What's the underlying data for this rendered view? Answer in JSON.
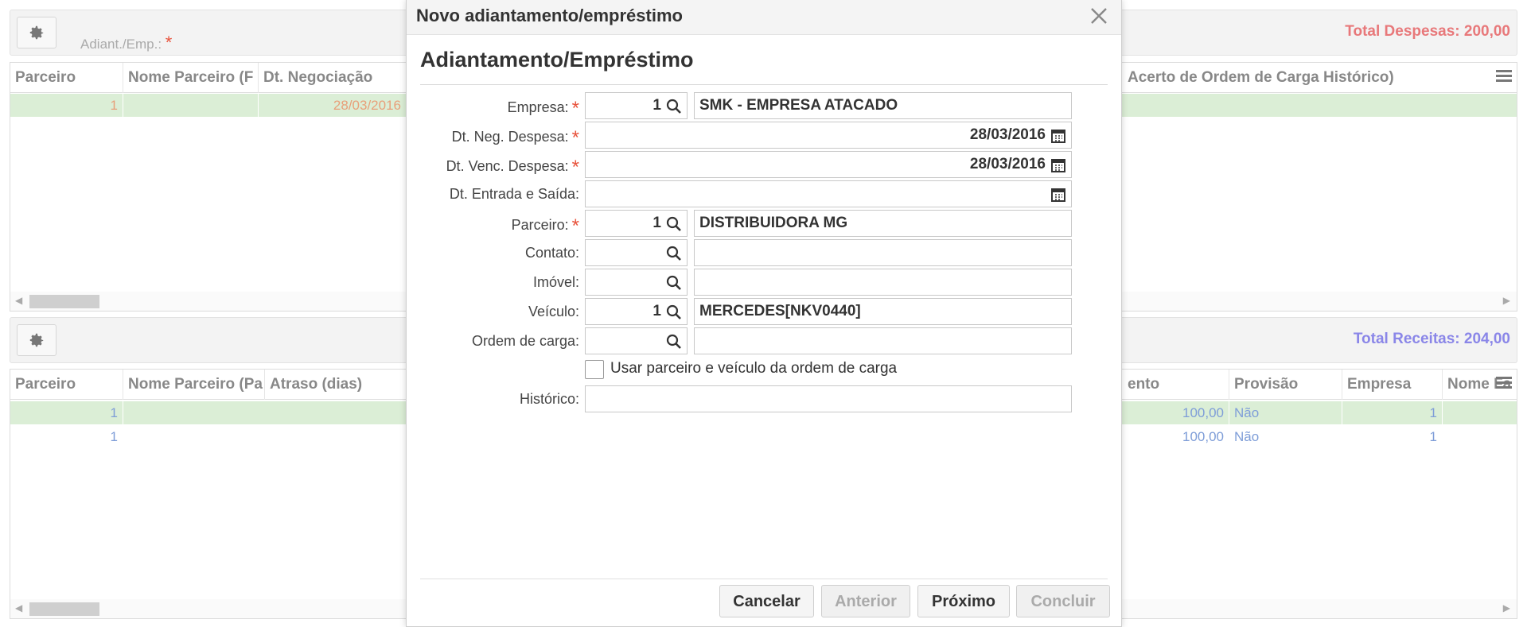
{
  "top_panel": {
    "field_label": "Adiant./Emp.:",
    "required_mark": "*",
    "total": "Total Despesas: 200,00",
    "total_color": "#e8787a"
  },
  "top_grid": {
    "headers": [
      "Parceiro",
      "Nome Parceiro (F",
      "Dt. Negociação",
      "Acerto de Ordem de Carga Histórico)"
    ],
    "rows": [
      {
        "parceiro": "1",
        "nome": "",
        "dt": "28/03/2016"
      }
    ]
  },
  "bottom_panel": {
    "total": "Total Receitas: 204,00",
    "total_color": "#8a86e8"
  },
  "bottom_grid": {
    "headers": [
      "Parceiro",
      "Nome Parceiro (Pa",
      "Atraso (dias)",
      "ento",
      "Provisão",
      "Empresa",
      "Nome Fa"
    ],
    "rows": [
      {
        "parceiro": "1",
        "valor": "100,00",
        "provisao": "Não",
        "empresa": "1"
      },
      {
        "parceiro": "1",
        "valor": "100,00",
        "provisao": "Não",
        "empresa": "1"
      }
    ]
  },
  "modal": {
    "title": "Novo adiantamento/empréstimo",
    "section_title": "Adiantamento/Empréstimo",
    "fields": {
      "empresa": {
        "label": "Empresa:",
        "code": "1",
        "desc": "SMK - EMPRESA ATACADO"
      },
      "dt_neg": {
        "label": "Dt. Neg. Despesa:",
        "value": "28/03/2016"
      },
      "dt_venc": {
        "label": "Dt. Venc. Despesa:",
        "value": "28/03/2016"
      },
      "dt_entrada": {
        "label": "Dt. Entrada e Saída:",
        "value": ""
      },
      "parceiro": {
        "label": "Parceiro:",
        "code": "1",
        "desc": "DISTRIBUIDORA MG"
      },
      "contato": {
        "label": "Contato:",
        "code": "",
        "desc": ""
      },
      "imovel": {
        "label": "Imóvel:",
        "code": "",
        "desc": ""
      },
      "veiculo": {
        "label": "Veículo:",
        "code": "1",
        "desc": "MERCEDES[NKV0440]"
      },
      "ordem": {
        "label": "Ordem de carga:",
        "code": "",
        "desc": ""
      },
      "usar_ordem": {
        "label": "Usar parceiro e veículo da ordem de carga",
        "checked": false
      },
      "historico": {
        "label": "Histórico:",
        "value": ""
      }
    },
    "required_mark": "*",
    "buttons": {
      "cancelar": "Cancelar",
      "anterior": "Anterior",
      "proximo": "Próximo",
      "concluir": "Concluir"
    }
  },
  "colors": {
    "required": "#e8543d",
    "selected_row": "#dbeed6",
    "top_row_text": "#e8a07a",
    "bottom_row_text": "#7f9ed8"
  }
}
